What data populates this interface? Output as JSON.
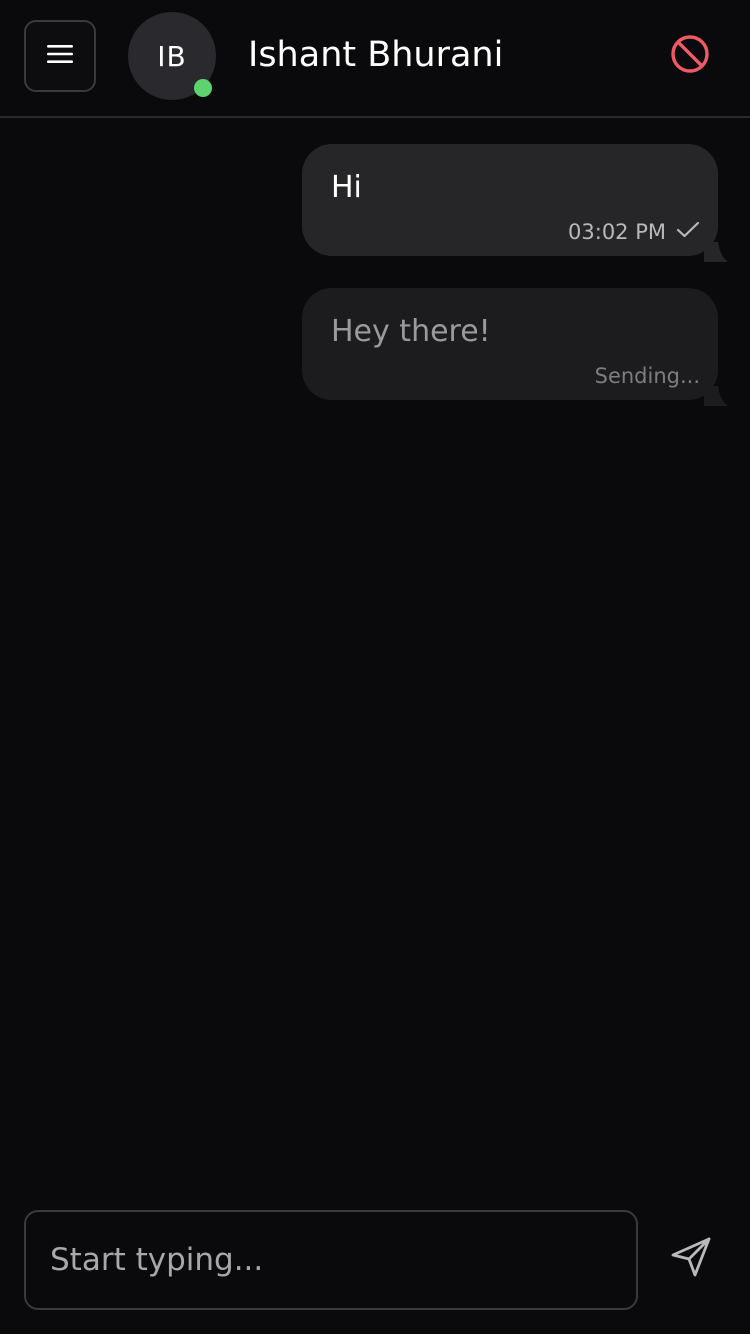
{
  "header": {
    "menu_icon": "hamburger-menu-icon",
    "avatar_initials": "IB",
    "contact_name": "Ishant Bhurani",
    "online_status_color": "#5ed26c",
    "block_icon": "block-icon",
    "block_icon_color": "#ef5a66"
  },
  "messages": [
    {
      "text": "Hi",
      "time": "03:02 PM",
      "status": "sent",
      "status_icon": "checkmark-icon"
    },
    {
      "text": "Hey there!",
      "status_text": "Sending..."
    }
  ],
  "composer": {
    "placeholder": "Start typing...",
    "value": "",
    "send_icon": "send-icon"
  }
}
